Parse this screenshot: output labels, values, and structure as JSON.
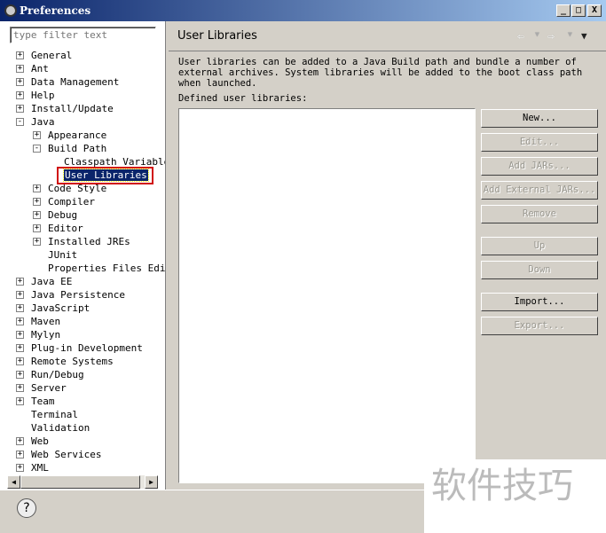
{
  "window": {
    "title": "Preferences",
    "minimize": "_",
    "maximize": "□",
    "close": "X"
  },
  "filter": {
    "placeholder": "type filter text"
  },
  "tree": [
    {
      "label": "General",
      "level": 0,
      "expander": "+"
    },
    {
      "label": "Ant",
      "level": 0,
      "expander": "+"
    },
    {
      "label": "Data Management",
      "level": 0,
      "expander": "+"
    },
    {
      "label": "Help",
      "level": 0,
      "expander": "+"
    },
    {
      "label": "Install/Update",
      "level": 0,
      "expander": "+"
    },
    {
      "label": "Java",
      "level": 0,
      "expander": "-"
    },
    {
      "label": "Appearance",
      "level": 1,
      "expander": "+"
    },
    {
      "label": "Build Path",
      "level": 1,
      "expander": "-"
    },
    {
      "label": "Classpath Variable",
      "level": 2,
      "expander": ""
    },
    {
      "label": "User Libraries",
      "level": 2,
      "expander": "",
      "selected": true
    },
    {
      "label": "Code Style",
      "level": 1,
      "expander": "+"
    },
    {
      "label": "Compiler",
      "level": 1,
      "expander": "+"
    },
    {
      "label": "Debug",
      "level": 1,
      "expander": "+"
    },
    {
      "label": "Editor",
      "level": 1,
      "expander": "+"
    },
    {
      "label": "Installed JREs",
      "level": 1,
      "expander": "+"
    },
    {
      "label": "JUnit",
      "level": 1,
      "expander": ""
    },
    {
      "label": "Properties Files Edit",
      "level": 1,
      "expander": ""
    },
    {
      "label": "Java EE",
      "level": 0,
      "expander": "+"
    },
    {
      "label": "Java Persistence",
      "level": 0,
      "expander": "+"
    },
    {
      "label": "JavaScript",
      "level": 0,
      "expander": "+"
    },
    {
      "label": "Maven",
      "level": 0,
      "expander": "+"
    },
    {
      "label": "Mylyn",
      "level": 0,
      "expander": "+"
    },
    {
      "label": "Plug-in Development",
      "level": 0,
      "expander": "+"
    },
    {
      "label": "Remote Systems",
      "level": 0,
      "expander": "+"
    },
    {
      "label": "Run/Debug",
      "level": 0,
      "expander": "+"
    },
    {
      "label": "Server",
      "level": 0,
      "expander": "+"
    },
    {
      "label": "Team",
      "level": 0,
      "expander": "+"
    },
    {
      "label": "Terminal",
      "level": 0,
      "expander": ""
    },
    {
      "label": "Validation",
      "level": 0,
      "expander": ""
    },
    {
      "label": "Web",
      "level": 0,
      "expander": "+"
    },
    {
      "label": "Web Services",
      "level": 0,
      "expander": "+"
    },
    {
      "label": "XML",
      "level": 0,
      "expander": "+"
    }
  ],
  "page": {
    "title": "User Libraries",
    "description": "User libraries can be added to a Java Build path and bundle a number of external archives. System libraries will be added to the boot class path when launched.",
    "list_label": "Defined user libraries:",
    "buttons": [
      {
        "label": "New...",
        "enabled": true
      },
      {
        "label": "Edit...",
        "enabled": false
      },
      {
        "label": "Add JARs...",
        "enabled": false
      },
      {
        "label": "Add External JARs...",
        "enabled": false
      },
      {
        "label": "Remove",
        "enabled": false
      },
      {
        "label": "Up",
        "enabled": false
      },
      {
        "label": "Down",
        "enabled": false
      },
      {
        "label": "Import...",
        "enabled": true
      },
      {
        "label": "Export...",
        "enabled": false
      }
    ]
  },
  "help": "?",
  "watermark": "软件技巧"
}
